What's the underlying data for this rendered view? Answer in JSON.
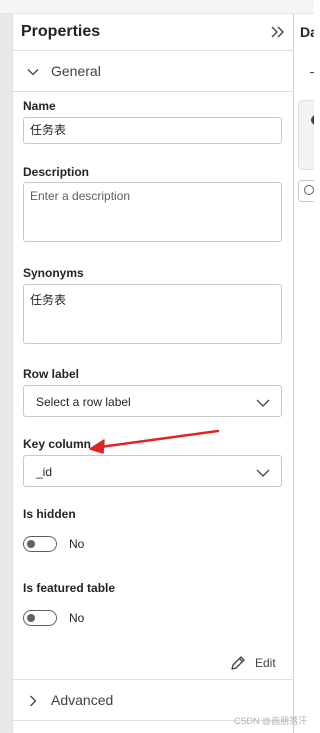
{
  "panel": {
    "title": "Properties",
    "collapse_icon": "double-chevron-right-icon"
  },
  "sections": {
    "general": {
      "label": "General",
      "expanded": true,
      "icon": "chevron-down-icon"
    },
    "advanced": {
      "label": "Advanced",
      "expanded": false,
      "icon": "chevron-right-icon"
    }
  },
  "fields": {
    "name": {
      "label": "Name",
      "value": "任务表"
    },
    "description": {
      "label": "Description",
      "value": "",
      "placeholder": "Enter a description"
    },
    "synonyms": {
      "label": "Synonyms",
      "value": "任务表"
    },
    "row_label": {
      "label": "Row label",
      "selected": "Select a row label"
    },
    "key_column": {
      "label": "Key column",
      "selected": "_id"
    },
    "is_hidden": {
      "label": "Is hidden",
      "state_text": "No",
      "on": false
    },
    "is_featured": {
      "label": "Is featured table",
      "state_text": "No",
      "on": false
    }
  },
  "edit": {
    "label": "Edit",
    "icon": "pencil-icon"
  },
  "right_panel": {
    "title_fragment": "Da"
  },
  "annotation": {
    "arrow_color": "#e02424"
  },
  "watermark": "CSDN @画朋落汗",
  "colors": {
    "accent": "#242424",
    "border": "#c8c8c8",
    "gutter": "#e9e8e7"
  }
}
